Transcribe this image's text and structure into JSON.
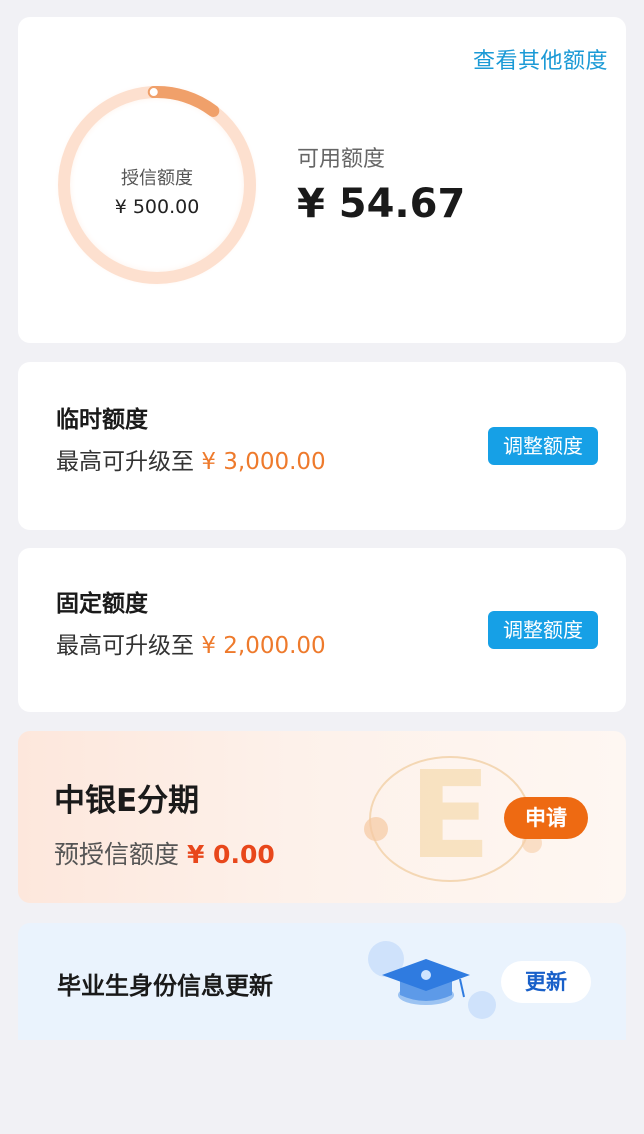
{
  "credit": {
    "other_link": "查看其他额度",
    "ring_label": "授信额度",
    "ring_amount": "¥ 500.00",
    "available_label": "可用额度",
    "available_amount": "¥ 54.67",
    "available_fraction": 0.109,
    "ring_color": "#f0a06a"
  },
  "temp_quota": {
    "title": "临时额度",
    "sub_prefix": "最高可升级至 ",
    "amount": "¥ 3,000.00",
    "button": "调整额度"
  },
  "fixed_quota": {
    "title": "固定额度",
    "sub_prefix": "最高可升级至 ",
    "amount": "¥ 2,000.00",
    "button": "调整额度"
  },
  "e_installment": {
    "title": "中银E分期",
    "sub_prefix": "预授信额度 ",
    "amount": "¥ 0.00",
    "button": "申请",
    "decor_letter": "E"
  },
  "graduate": {
    "title": "毕业生身份信息更新",
    "button": "更新",
    "icon": "graduation-cap-icon"
  },
  "colors": {
    "accent_blue": "#16a0e6",
    "accent_orange": "#ee7a2c",
    "apply_orange": "#ee6a12",
    "update_blue": "#1960c9"
  }
}
